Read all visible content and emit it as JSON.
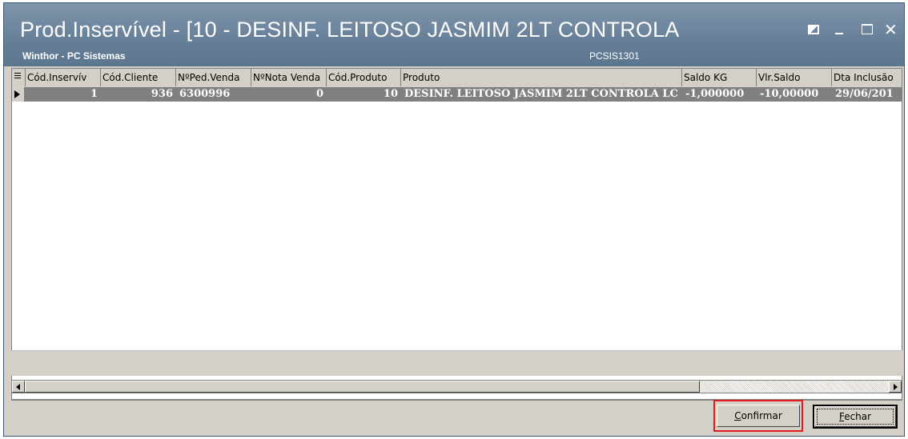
{
  "window": {
    "title": "Prod.Inservível - [10 - DESINF. LEITOSO JASMIM 2LT CONTROLA",
    "subtitle": "Winthor - PC Sistemas",
    "code": "PCSIS1301"
  },
  "titlebar_buttons": {
    "minimize": "–",
    "close": "✕"
  },
  "grid": {
    "columns": [
      "Cód.Inservív",
      "Cód.Cliente",
      "NºPed.Venda",
      "NºNota Venda",
      "Cód.Produto",
      "Produto",
      "Saldo KG",
      "Vlr.Saldo",
      "Dta Inclusão"
    ],
    "rows": [
      [
        "1",
        "936",
        "6300996",
        "0",
        "10",
        "DESINF. LEITOSO JASMIM 2LT CONTROLA LC",
        "-1,000000",
        "-10,00000",
        "29/06/201"
      ]
    ]
  },
  "buttons": {
    "confirm": "Confirmar",
    "confirm_accel": "C",
    "confirm_rest": "onfirmar",
    "close": "Fechar",
    "close_accel": "F",
    "close_rest": "echar"
  },
  "colors": {
    "titlebar": "#667f98",
    "selected_row": "#808080",
    "highlight": "#e01c1c",
    "face": "#d4d0c8"
  }
}
